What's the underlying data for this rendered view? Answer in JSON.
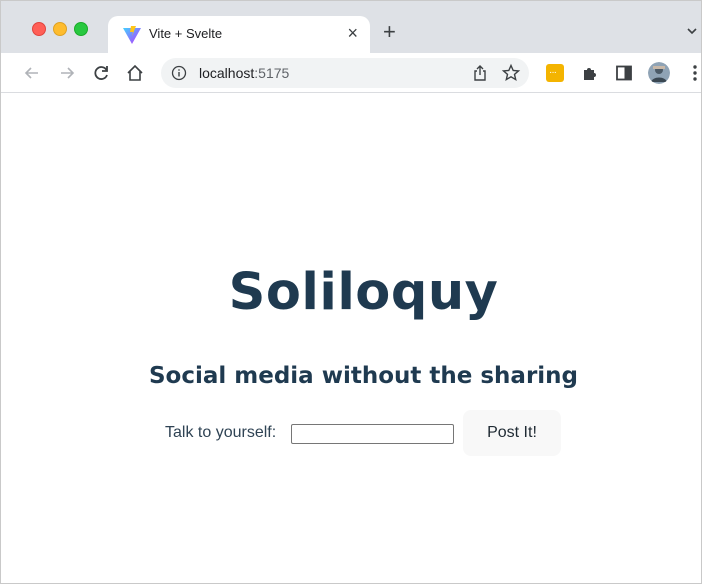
{
  "browser": {
    "tab": {
      "title": "Vite + Svelte",
      "close": "×"
    },
    "new_tab": "+",
    "address": {
      "host": "localhost",
      "port": ":5175"
    },
    "extension_badge": "···"
  },
  "page": {
    "title": "Soliloquy",
    "subtitle": "Social media without the sharing",
    "form": {
      "label": "Talk to yourself:",
      "input_value": "",
      "button_label": "Post It!"
    }
  },
  "colors": {
    "heading": "#1f3a50",
    "tabstrip": "#dee1e6",
    "button_bg": "#f8f8f8"
  },
  "icons": [
    "vite-favicon-icon",
    "close-icon",
    "plus-icon",
    "chevron-down-icon",
    "back-arrow-icon",
    "forward-arrow-icon",
    "reload-icon",
    "home-icon",
    "info-icon",
    "share-icon",
    "star-icon",
    "extension-icon",
    "puzzle-icon",
    "sidepanel-icon",
    "avatar",
    "kebab-menu-icon"
  ]
}
